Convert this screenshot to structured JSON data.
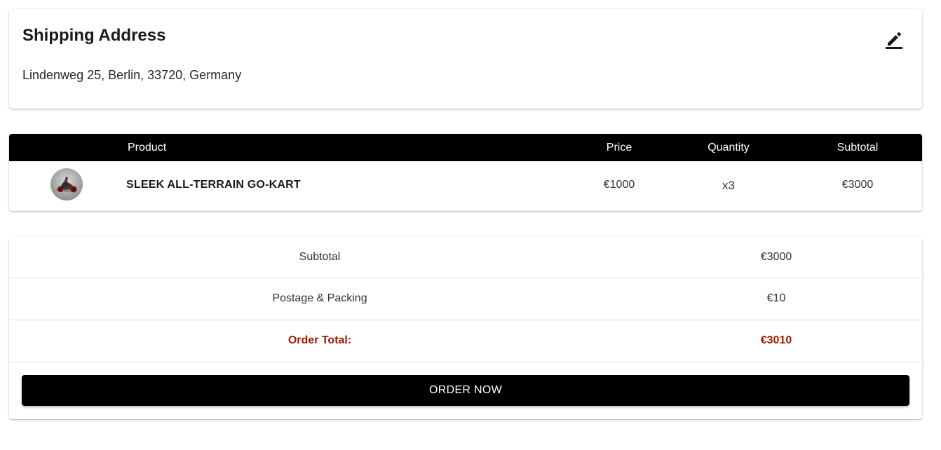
{
  "shipping": {
    "title": "Shipping Address",
    "address": "Lindenweg 25, Berlin, 33720, Germany",
    "edit_icon": "edit-icon"
  },
  "product_table": {
    "columns": [
      "",
      "Product",
      "Price",
      "Quantity",
      "Subtotal"
    ],
    "rows": [
      {
        "image_icon": "go-kart-thumbnail",
        "name": "SLEEK ALL-TERRAIN GO-KART",
        "price": "€1000",
        "quantity": "x3",
        "subtotal": "€3000"
      }
    ]
  },
  "summary": {
    "subtotal_label": "Subtotal",
    "subtotal_value": "€3000",
    "postage_label": "Postage & Packing",
    "postage_value": "€10",
    "total_label": "Order Total:",
    "total_value": "€3010",
    "order_button": "ORDER NOW"
  },
  "colors": {
    "accent_red": "#9b1c00",
    "header_black": "#000000",
    "button_black": "#000000"
  }
}
